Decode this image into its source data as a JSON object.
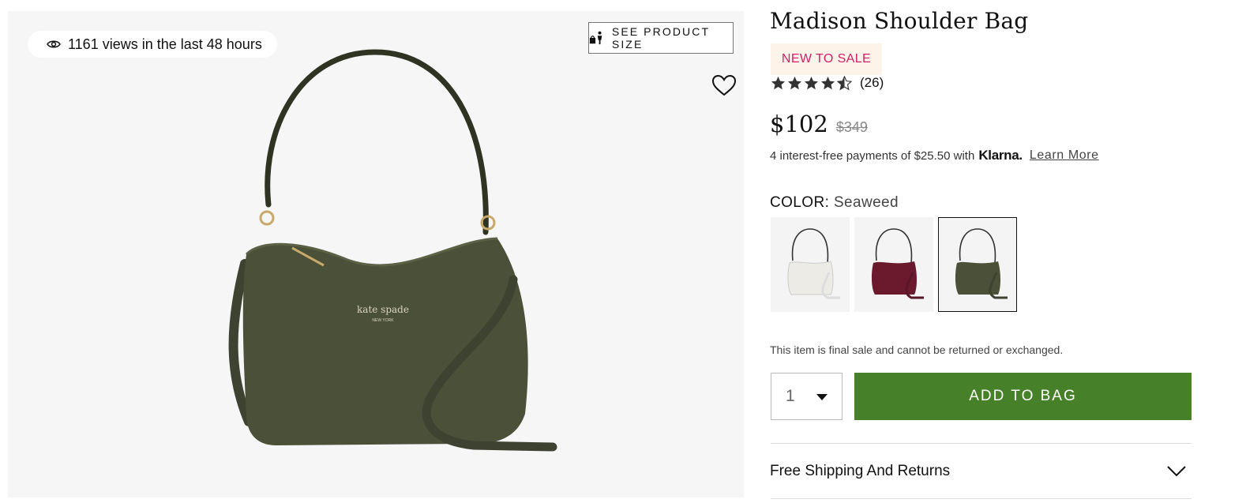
{
  "gallery": {
    "views_text": "1161 views in the last 48 hours",
    "size_button_label": "SEE PRODUCT SIZE",
    "brand_mark": "kate spade",
    "brand_sub": "NEW YORK"
  },
  "product": {
    "title": "Madison Shoulder Bag",
    "badge": "NEW TO SALE",
    "rating": 4.5,
    "rating_max": 5,
    "review_count": "(26)",
    "price": "$102",
    "original_price": "$349",
    "klarna_text": "4 interest-free payments of $25.50 with",
    "klarna_logo": "Klarna.",
    "learn_more": "Learn More",
    "color_label": "COLOR:",
    "color_value": "Seaweed",
    "swatches": [
      {
        "name": "Parchment",
        "color": "#ecebe6",
        "selected": false
      },
      {
        "name": "Burgundy",
        "color": "#6b1a2e",
        "selected": false
      },
      {
        "name": "Seaweed",
        "color": "#4b5138",
        "selected": true
      }
    ],
    "final_sale_note": "This item is final sale and cannot be returned or exchanged.",
    "quantity": "1",
    "add_to_bag": "ADD TO BAG",
    "shipping_label": "Free Shipping And Returns"
  },
  "colors": {
    "accent_green": "#468129",
    "sale_pink": "#d11f6a",
    "badge_bg": "#fdf3e8",
    "bag_color": "#4b5138"
  }
}
